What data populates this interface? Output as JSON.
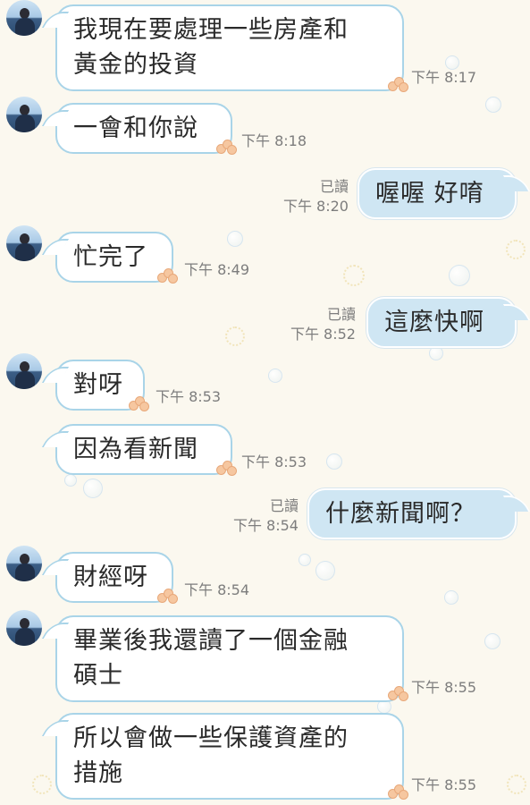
{
  "chat": {
    "read_label": "已讀",
    "messages": [
      {
        "side": "in",
        "text": "我現在要處理一些房產和\n黃金的投資",
        "time": "下午 8:17"
      },
      {
        "side": "in",
        "text": "一會和你說",
        "time": "下午 8:18"
      },
      {
        "side": "out",
        "text": "喔喔 好唷",
        "time": "下午 8:20",
        "read": "已讀"
      },
      {
        "side": "in",
        "text": "忙完了",
        "time": "下午 8:49"
      },
      {
        "side": "out",
        "text": "這麼快啊",
        "time": "下午 8:52",
        "read": "已讀"
      },
      {
        "side": "in",
        "text": "對呀",
        "time": "下午 8:53"
      },
      {
        "side": "in",
        "text": "因為看新聞",
        "time": "下午 8:53"
      },
      {
        "side": "out",
        "text": "什麼新聞啊？",
        "time": "下午 8:54",
        "read": "已讀"
      },
      {
        "side": "in",
        "text": "財經呀",
        "time": "下午 8:54"
      },
      {
        "side": "in",
        "text": "畢業後我還讀了一個金融\n碩士",
        "time": "下午 8:55"
      },
      {
        "side": "in",
        "text": "所以會做一些保護資產的\n措施",
        "time": "下午 8:55"
      }
    ]
  },
  "colors": {
    "background": "#fbf8ef",
    "incoming_bubble": "#ffffff",
    "incoming_border": "#a9d4e8",
    "outgoing_bubble": "#cfe6f3",
    "meta_text": "#7d7d7d"
  }
}
